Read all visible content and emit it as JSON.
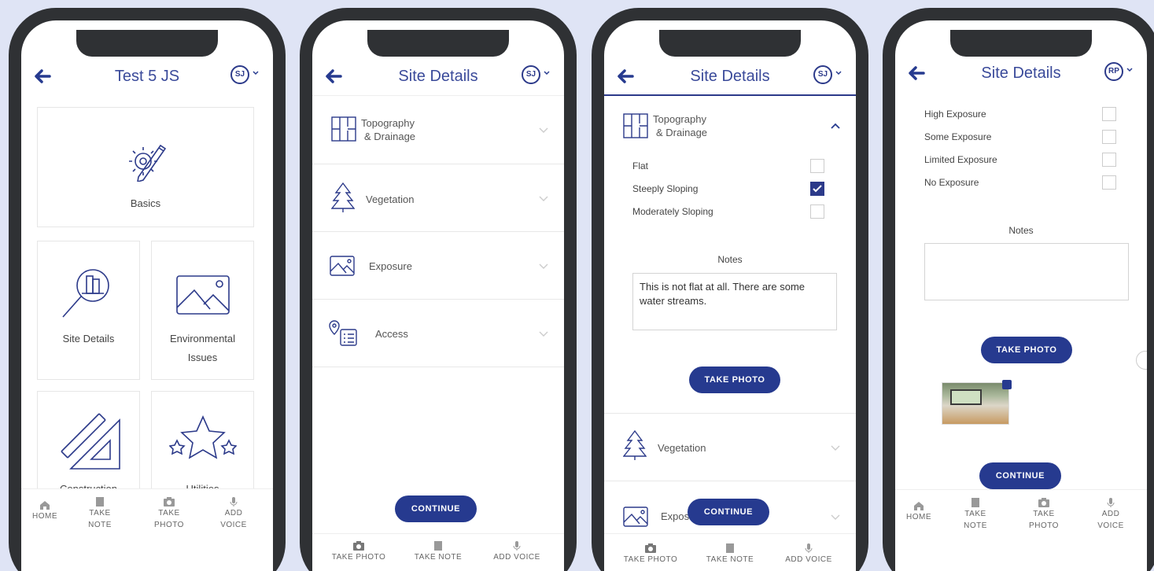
{
  "colors": {
    "accent": "#263a8f",
    "phone_frame": "#2f3134",
    "background": "#dfe4f5"
  },
  "screen1": {
    "title": "Test 5 JS",
    "avatar": "SJ",
    "cards": [
      {
        "label": "Basics",
        "icon": "gear-pencil-icon"
      },
      {
        "label": "Site Details",
        "icon": "magnifier-building-icon"
      },
      {
        "label": "Environmental",
        "label2": "Issues",
        "icon": "landscape-icon"
      },
      {
        "label": "Construction",
        "icon": "ruler-square-icon"
      },
      {
        "label": "Utilities",
        "icon": "stars-icon"
      }
    ],
    "nav": {
      "home": "HOME",
      "take_note_1": "TAKE",
      "take_note_2": "NOTE",
      "take_photo_1": "TAKE",
      "take_photo_2": "PHOTO",
      "add_voice_1": "ADD",
      "add_voice_2": "VOICE"
    }
  },
  "screen2": {
    "title": "Site Details",
    "avatar": "SJ",
    "sections": [
      {
        "label": "Topography",
        "label2": "& Drainage",
        "icon": "floor-plan-icon"
      },
      {
        "label": "Vegetation",
        "icon": "tree-icon"
      },
      {
        "label": "Exposure",
        "icon": "landscape-icon"
      },
      {
        "label": "Access",
        "icon": "map-pin-list-icon"
      }
    ],
    "continue": "CONTINUE",
    "nav": {
      "take_photo": "TAKE PHOTO",
      "take_note": "TAKE NOTE",
      "add_voice": "ADD VOICE"
    }
  },
  "screen3": {
    "title": "Site Details",
    "avatar": "SJ",
    "section_label": "Topography",
    "section_label2": "& Drainage",
    "options": [
      {
        "label": "Flat",
        "checked": false
      },
      {
        "label": "Steeply Sloping",
        "checked": true
      },
      {
        "label": "Moderately Sloping",
        "checked": false
      }
    ],
    "notes_label": "Notes",
    "notes_value": "This is not flat at all. There are some water streams.",
    "take_photo": "TAKE PHOTO",
    "vegetation": "Vegetation",
    "exposure_partial": "Expos",
    "continue": "CONTINUE",
    "nav": {
      "take_photo": "TAKE PHOTO",
      "take_note": "TAKE NOTE",
      "add_voice": "ADD VOICE"
    }
  },
  "screen4": {
    "title": "Site Details",
    "avatar": "RP",
    "options": [
      {
        "label": "High Exposure",
        "checked": false
      },
      {
        "label": "Some Exposure",
        "checked": false
      },
      {
        "label": "Limited Exposure",
        "checked": false
      },
      {
        "label": "No Exposure",
        "checked": false
      }
    ],
    "notes_label": "Notes",
    "notes_value": "",
    "take_photo": "TAKE PHOTO",
    "continue": "CONTINUE",
    "nav": {
      "home": "HOME",
      "take_note_1": "TAKE",
      "take_note_2": "NOTE",
      "take_photo_1": "TAKE",
      "take_photo_2": "PHOTO",
      "add_voice_1": "ADD",
      "add_voice_2": "VOICE"
    }
  }
}
